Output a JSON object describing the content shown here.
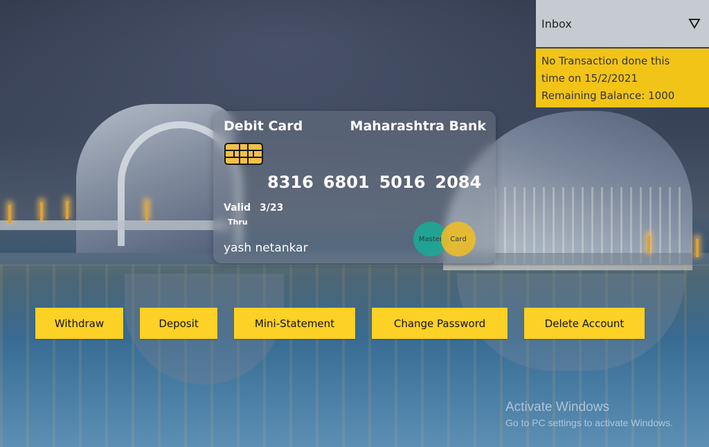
{
  "inbox": {
    "label": "Inbox",
    "arrow_icon": "triangle-down-icon",
    "messages": [
      "No Transaction done this",
      "time on 15/2/2021",
      "Remaining Balance: 1000"
    ]
  },
  "card": {
    "title": "Debit Card",
    "bank": "Maharashtra Bank",
    "number": [
      "8316",
      "6801",
      "5016",
      "2084"
    ],
    "valid_label": "Valid",
    "thru_label": "Thru",
    "valid_date": "3/23",
    "holder": "yash netankar",
    "brand_left": "Master",
    "brand_right": "Card",
    "chip_icon": "card-chip-icon"
  },
  "actions": {
    "withdraw": "Withdraw",
    "deposit": "Deposit",
    "mini_statement": "Mini-Statement",
    "change_password": "Change Password",
    "delete_account": "Delete Account"
  },
  "watermark": {
    "title": "Activate Windows",
    "subtitle": "Go to PC settings to activate Windows."
  },
  "colors": {
    "accent": "#fdd125",
    "inbox_panel": "#f2c417",
    "inbox_header": "#c6cbd1",
    "mastercard_teal": "#1ca896",
    "mastercard_yellow": "#f2be20"
  }
}
